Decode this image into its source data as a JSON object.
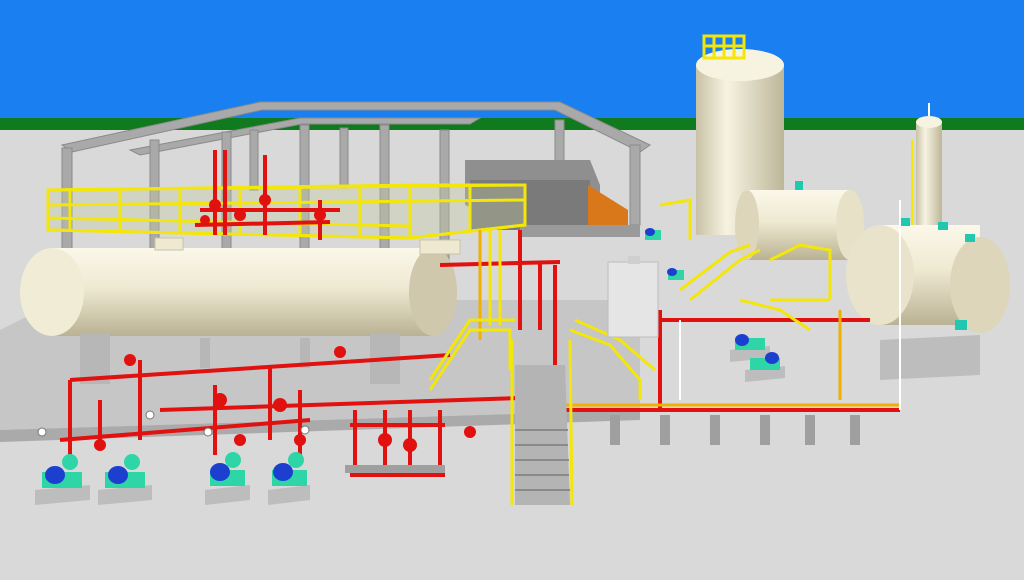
{
  "scene": {
    "colors": {
      "sky": "#1a7ff0",
      "horizon_grass": "#0f7a1e",
      "ground": "#d9d9d9",
      "concrete": "#b9b9b9",
      "steel_structure": "#9c9c9c",
      "vessel": "#efe9d2",
      "vessel_shade": "#c9c2a6",
      "handrail": "#f3e60b",
      "process_pipe": "#e0110f",
      "utility_pipe": "#f0b000",
      "instrument_pipe": "#ffffff",
      "pump_motor": "#1d3fcf",
      "pump_casing": "#2ed5a6",
      "nozzle": "#21c8b0",
      "wall_orange": "#d9781b"
    }
  }
}
